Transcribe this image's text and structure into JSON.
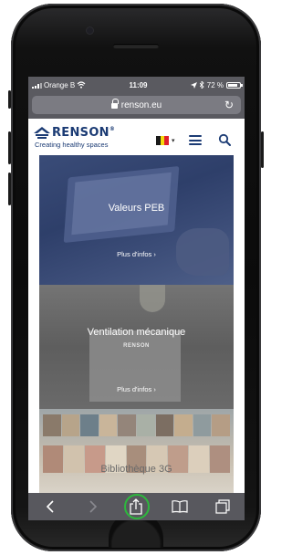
{
  "status_bar": {
    "carrier": "Orange B",
    "time": "11:09",
    "battery": "72 %"
  },
  "browser": {
    "url": "renson.eu"
  },
  "site": {
    "logo_text": "RENSON",
    "logo_reg": "®",
    "tagline": "Creating healthy spaces"
  },
  "tiles": [
    {
      "title": "Valeurs PEB",
      "link": "Plus d'infos ›"
    },
    {
      "title": "Ventilation mécanique",
      "link": "Plus d'infos ›",
      "brand": "RENSON"
    },
    {
      "title": "Bibliothèque 3G"
    }
  ],
  "toolbar_icons": [
    "back-icon",
    "forward-icon",
    "share-icon",
    "bookmarks-icon",
    "tabs-icon"
  ],
  "colors": {
    "brand": "#1b3b74",
    "toolbar": "#58585e",
    "share_highlight": "#2db83d",
    "flag_black": "#1a1a1a",
    "flag_yellow": "#f5d90c",
    "flag_red": "#e0202c"
  }
}
